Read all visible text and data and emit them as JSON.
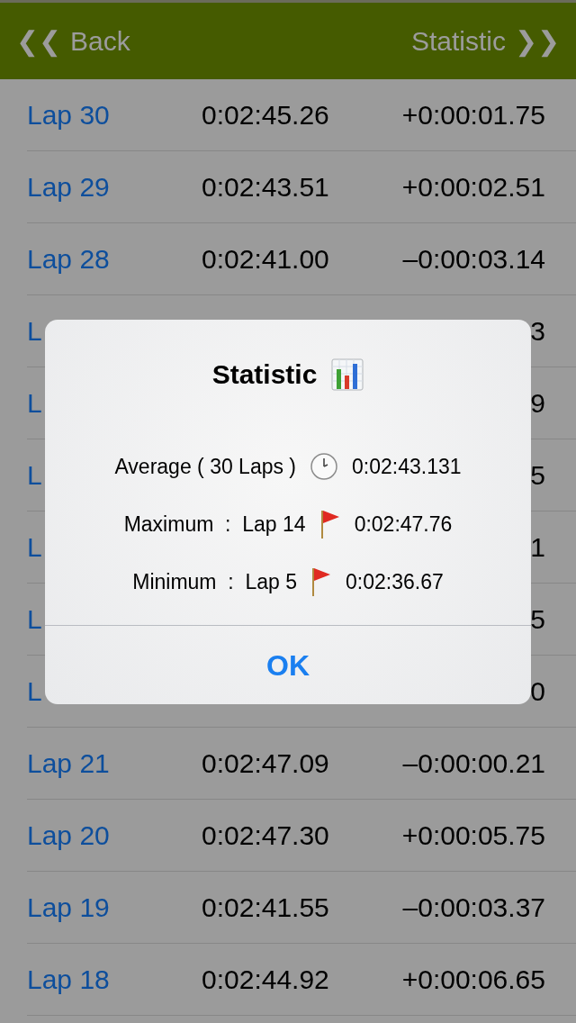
{
  "nav": {
    "back": {
      "icon": "❮❮",
      "label": "Back"
    },
    "forward": {
      "label": "Statistic",
      "icon": "❯❯"
    }
  },
  "rows": [
    {
      "lap": "Lap 30",
      "time": "0:02:45.26",
      "delta": "+0:00:01.75"
    },
    {
      "lap": "Lap 29",
      "time": "0:02:43.51",
      "delta": "+0:00:02.51"
    },
    {
      "lap": "Lap 28",
      "time": "0:02:41.00",
      "delta": "–0:00:03.14"
    },
    {
      "lap": "L",
      "delta": "3"
    },
    {
      "lap": "L",
      "delta": "9"
    },
    {
      "lap": "L",
      "delta": "5"
    },
    {
      "lap": "L",
      "delta": "1"
    },
    {
      "lap": "L",
      "delta": "5"
    },
    {
      "lap": "L",
      "delta": "0"
    },
    {
      "lap": "Lap 21",
      "time": "0:02:47.09",
      "delta": "–0:00:00.21"
    },
    {
      "lap": "Lap 20",
      "time": "0:02:47.30",
      "delta": "+0:00:05.75"
    },
    {
      "lap": "Lap 19",
      "time": "0:02:41.55",
      "delta": "–0:00:03.37"
    },
    {
      "lap": "Lap 18",
      "time": "0:02:44.92",
      "delta": "+0:00:06.65"
    }
  ],
  "dialog": {
    "title": "Statistic",
    "lines": [
      {
        "kind": "clock",
        "label": "Average ( 30 Laps )",
        "value": "0:02:43.131"
      },
      {
        "kind": "flag",
        "label": "Maximum  :  Lap 14",
        "value": "0:02:47.76"
      },
      {
        "kind": "flag",
        "label": "Minimum  :  Lap 5",
        "value": "0:02:36.67"
      }
    ],
    "button": "OK"
  }
}
